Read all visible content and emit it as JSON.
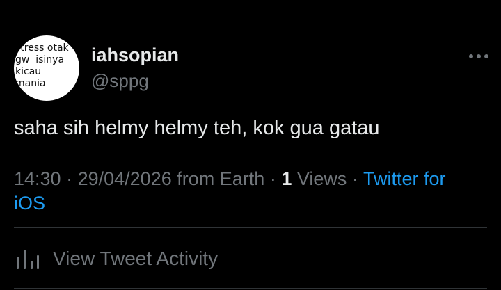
{
  "author": {
    "avatar_text": "stress otak\ngw  isinya\nkicau\nmania",
    "display_name": "iahsopian",
    "handle": "@sppg"
  },
  "menu": {
    "icon": "more-horizontal-icon"
  },
  "tweet": {
    "text": "saha sih helmy helmy teh, kok gua gatau",
    "time": "14:30",
    "date": "29/04/2026",
    "location": "from Earth",
    "views_count": "1",
    "views_label": "Views",
    "source": "Twitter for iOS"
  },
  "activity": {
    "icon": "analytics-bar-icon",
    "label": "View Tweet Activity"
  },
  "colors": {
    "background": "#000000",
    "primary_text": "#e7e9ea",
    "secondary_text": "#71767b",
    "link": "#1d9bf0",
    "divider": "#2f3336"
  }
}
